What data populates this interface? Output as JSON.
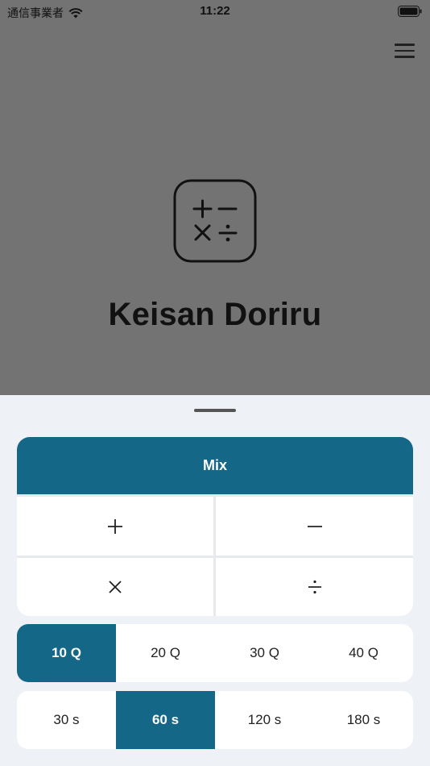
{
  "status_bar": {
    "carrier": "通信事業者",
    "time": "11:22"
  },
  "app": {
    "title": "Keisan Doriru"
  },
  "modes": {
    "mix_label": "Mix",
    "operators": [
      {
        "icon": "plus-icon"
      },
      {
        "icon": "minus-icon"
      },
      {
        "icon": "multiply-icon"
      },
      {
        "icon": "divide-icon"
      }
    ]
  },
  "questions": {
    "options": [
      "10 Q",
      "20 Q",
      "30 Q",
      "40 Q"
    ],
    "selected": "10 Q"
  },
  "time_limit": {
    "options": [
      "30 s",
      "60 s",
      "120 s",
      "180 s"
    ],
    "selected": "60 s"
  },
  "colors": {
    "accent": "#156787",
    "backdrop": "#737373",
    "sheet": "#eef2f7"
  }
}
